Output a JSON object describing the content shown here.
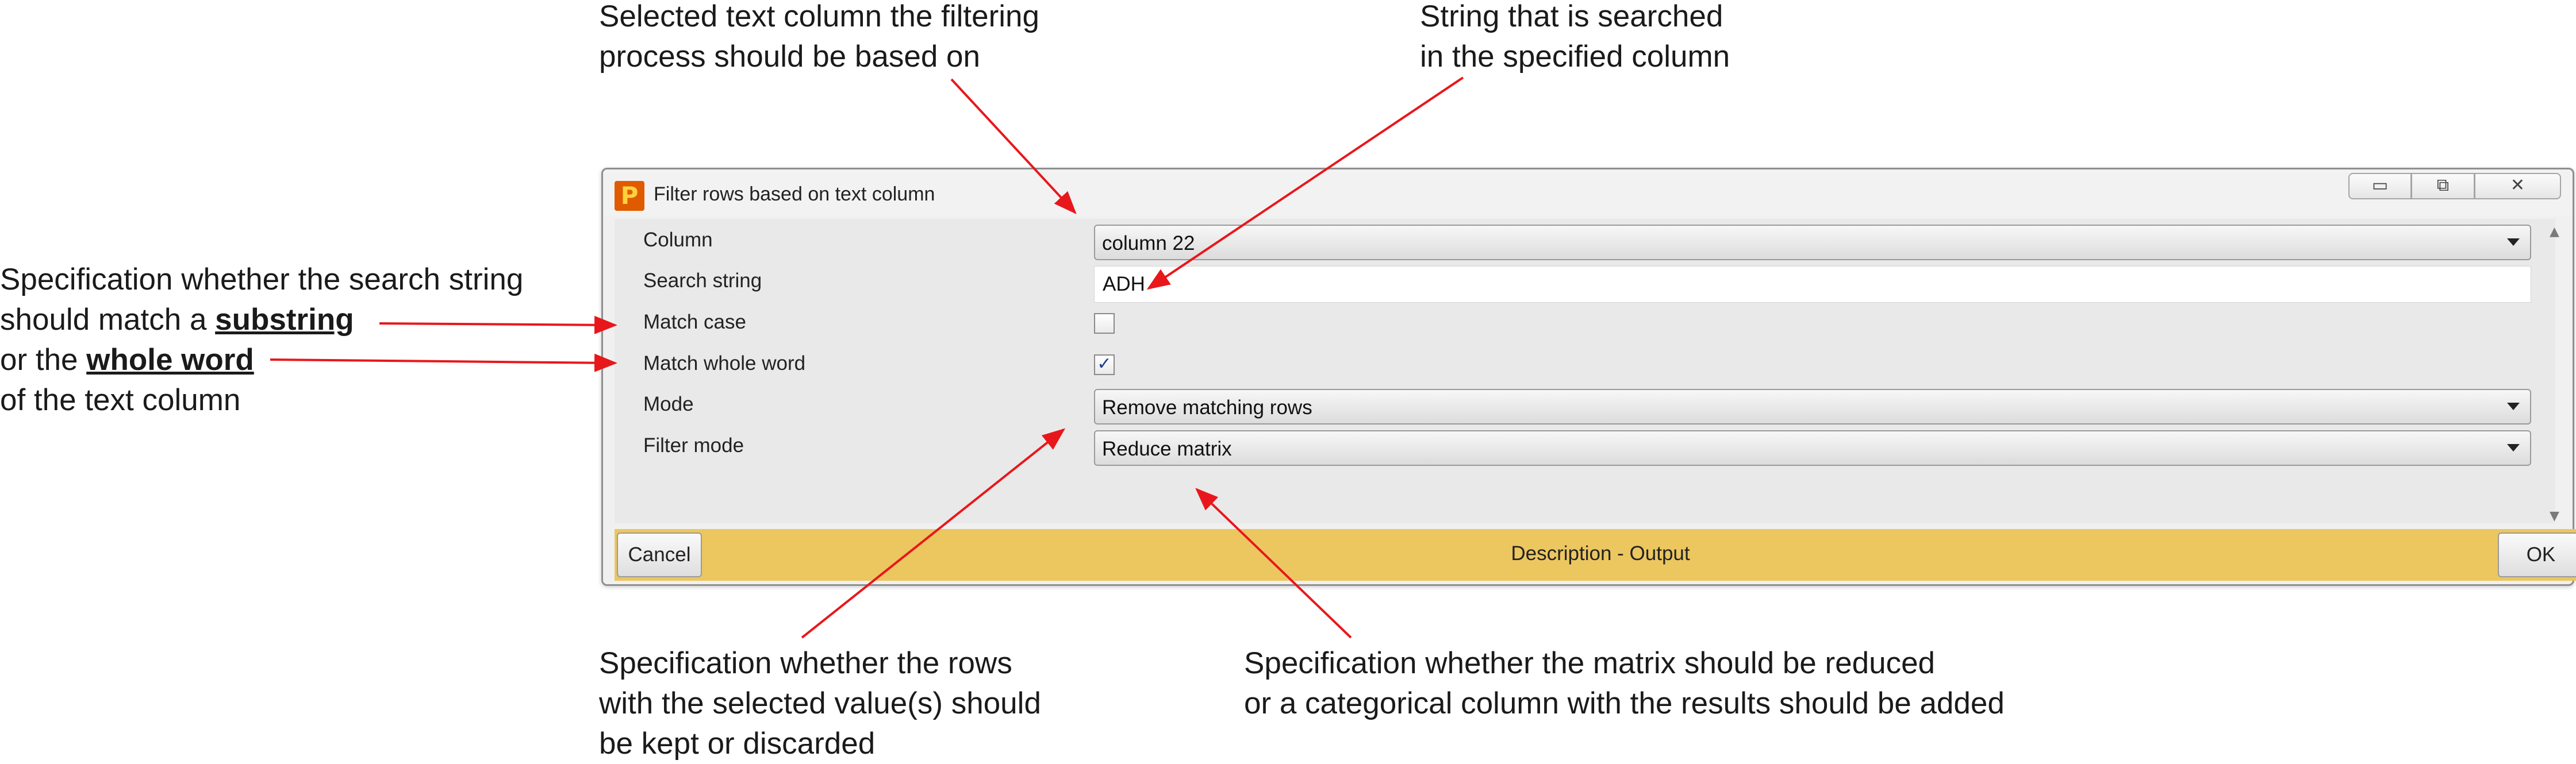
{
  "annotations": {
    "column": [
      "Selected text column the filtering",
      "process should be based on"
    ],
    "search": [
      "String that is searched",
      "in the specified column"
    ],
    "match": {
      "line1": "Specification whether the search string",
      "line2_pre": "should match a ",
      "line2_bold": "substring",
      "line3_pre": "or the ",
      "line3_bold": "whole word",
      "line4": "of the text column"
    },
    "mode": [
      "Specification whether the rows",
      "with the selected value(s) should",
      "be kept or discarded"
    ],
    "filter_mode": [
      "Specification whether the matrix should be reduced",
      "or a categorical column with the results should be added"
    ]
  },
  "window": {
    "title": "Filter rows based on text column",
    "icon": "p-app-icon",
    "controls": [
      "minimize-icon",
      "maximize-icon",
      "close-icon"
    ]
  },
  "form": {
    "column": {
      "label": "Column",
      "value": "column 22"
    },
    "search_string": {
      "label": "Search string",
      "value": "ADH"
    },
    "match_case": {
      "label": "Match case",
      "checked": false
    },
    "match_whole_word": {
      "label": "Match whole word",
      "checked": true
    },
    "mode": {
      "label": "Mode",
      "value": "Remove matching rows"
    },
    "filter_mode": {
      "label": "Filter mode",
      "value": "Reduce matrix"
    }
  },
  "footer": {
    "cancel_label": "Cancel",
    "description": "Description - Output",
    "ok_label": "OK",
    "color": "#ecc65f"
  },
  "colors": {
    "arrow": "#e8171b"
  }
}
